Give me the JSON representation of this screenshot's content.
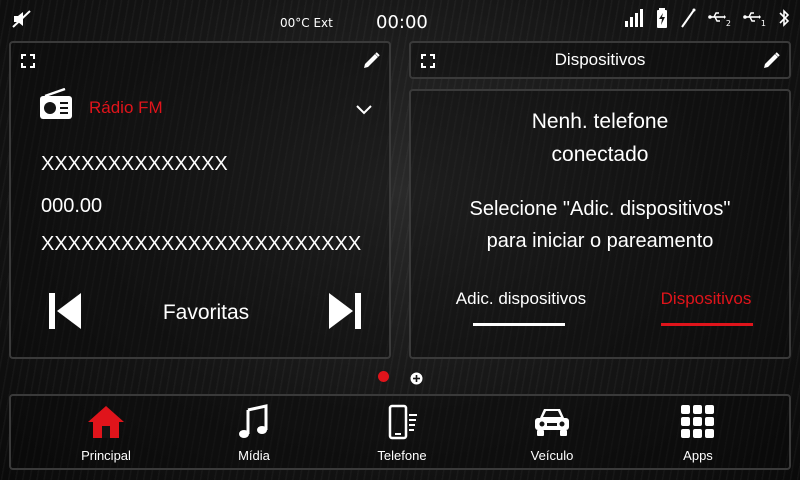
{
  "status": {
    "temperature": "00°C Ext",
    "clock": "00:00",
    "usb2_index": "2",
    "usb1_index": "1"
  },
  "radio": {
    "source": "Rádio FM",
    "line1": "XXXXXXXXXXXXXX",
    "frequency": "000.00",
    "line2": "XXXXXXXXXXXXXXXXXXXXXXXX",
    "favorites": "Favoritas"
  },
  "devices": {
    "title": "Dispositivos",
    "message_line1": "Nenh. telefone",
    "message_line2": "conectado",
    "hint_line1": "Selecione \"Adic. dispositivos\"",
    "hint_line2": "para iniciar o pareamento",
    "tab_add": "Adic. dispositivos",
    "tab_devices": "Dispositivos"
  },
  "nav": {
    "items": [
      {
        "label": "Principal",
        "icon": "home-icon",
        "color": "#e0141b"
      },
      {
        "label": "Mídia",
        "icon": "music-note-icon",
        "color": "#ffffff"
      },
      {
        "label": "Telefone",
        "icon": "phone-icon",
        "color": "#ffffff"
      },
      {
        "label": "Veículo",
        "icon": "car-icon",
        "color": "#ffffff"
      },
      {
        "label": "Apps",
        "icon": "apps-grid-icon",
        "color": "#ffffff"
      }
    ]
  },
  "colors": {
    "accent": "#e0141b",
    "text": "#ffffff",
    "border": "#3a3a3a"
  }
}
